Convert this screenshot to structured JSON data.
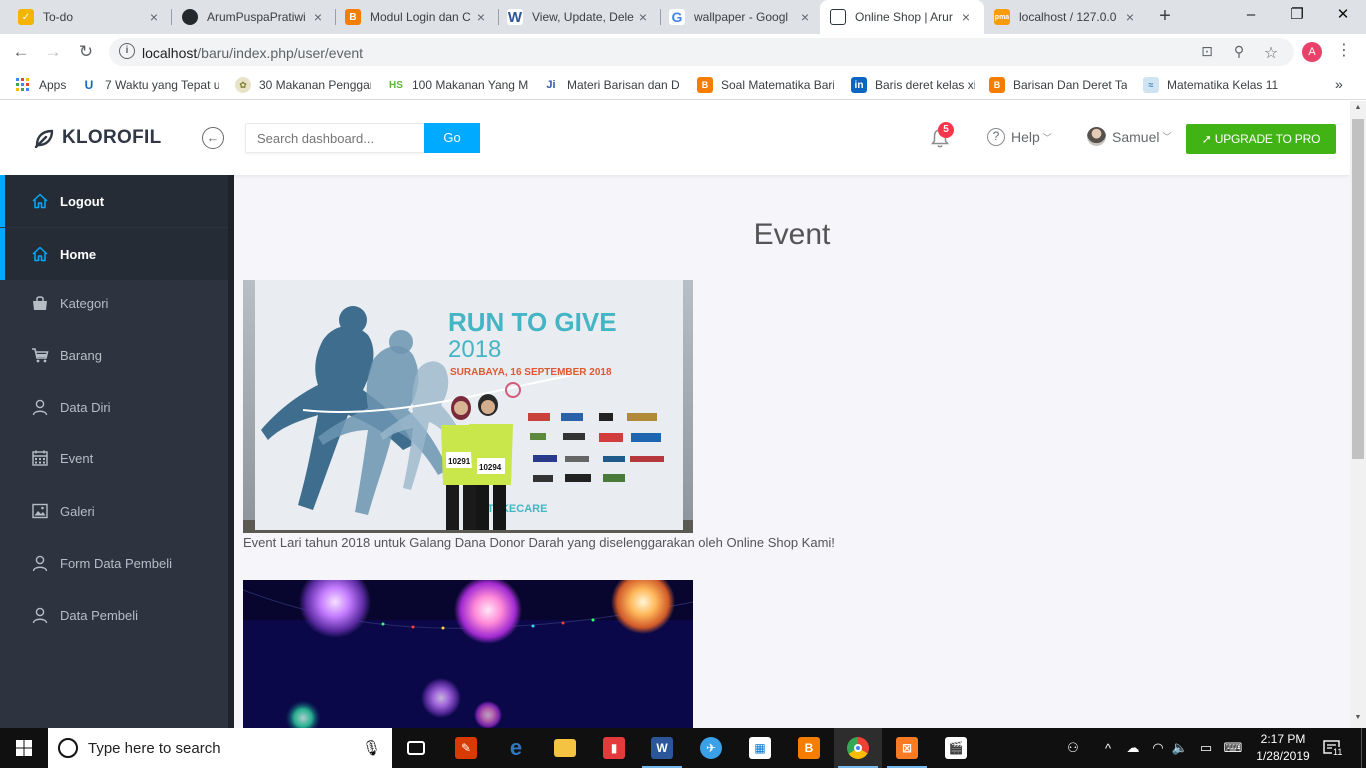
{
  "browser": {
    "tabs": [
      {
        "title": "To-do",
        "icon": "todo-icon",
        "color": "#f5b400"
      },
      {
        "title": "ArumPuspaPratiwi",
        "icon": "github-icon",
        "color": "#24292e"
      },
      {
        "title": "Modul Login dan C",
        "icon": "blogger-icon",
        "color": "#f57d00"
      },
      {
        "title": "View, Update, Dele",
        "icon": "word-icon",
        "color": "#2b579a"
      },
      {
        "title": "wallpaper - Googl",
        "icon": "google-icon",
        "color": "#4285f4"
      },
      {
        "title": "Online Shop | Arur",
        "icon": "klorofil-icon",
        "color": "#2d3440"
      },
      {
        "title": "localhost / 127.0.0",
        "icon": "phpmyadmin-icon",
        "color": "#f89c0e"
      }
    ],
    "url_host": "localhost",
    "url_path": "/baru/index.php/user/event",
    "profile_initial": "A",
    "bookmarks": [
      {
        "label": "Apps",
        "icon": "apps-icon",
        "color": "#4285f4"
      },
      {
        "label": "7 Waktu yang Tepat u",
        "icon": "uo-icon",
        "color": "#1565c0"
      },
      {
        "label": "30 Makanan Penggan",
        "icon": "food-icon",
        "color": "#7c7c2e"
      },
      {
        "label": "100 Makanan Yang M",
        "icon": "hs-icon",
        "color": "#5fb336"
      },
      {
        "label": "Materi Barisan dan D",
        "icon": "ji-icon",
        "color": "#2e58a6"
      },
      {
        "label": "Soal Matematika Bari",
        "icon": "blogger-icon",
        "color": "#f57d00"
      },
      {
        "label": "Baris deret kelas xi",
        "icon": "linkedin-icon",
        "color": "#0a66c2"
      },
      {
        "label": "Barisan Dan Deret Tak",
        "icon": "blogger-icon",
        "color": "#f57d00"
      },
      {
        "label": "Matematika Kelas 11",
        "icon": "math-icon",
        "color": "#7ab3d9"
      }
    ]
  },
  "header": {
    "brand": "KLOROFIL",
    "search_placeholder": "Search dashboard...",
    "go_label": "Go",
    "notif_count": "5",
    "help_label": "Help",
    "user_name": "Samuel",
    "upgrade_label": "UPGRADE TO PRO"
  },
  "sidebar": {
    "items": [
      {
        "label": "Logout",
        "icon": "home-icon"
      },
      {
        "label": "Home",
        "icon": "home-icon"
      },
      {
        "label": "Kategori",
        "icon": "bag-icon"
      },
      {
        "label": "Barang",
        "icon": "cart-icon"
      },
      {
        "label": "Data Diri",
        "icon": "user-icon"
      },
      {
        "label": "Event",
        "icon": "calendar-icon"
      },
      {
        "label": "Galeri",
        "icon": "picture-icon"
      },
      {
        "label": "Form Data Pembeli",
        "icon": "user-icon"
      },
      {
        "label": "Data Pembeli",
        "icon": "user-icon"
      }
    ]
  },
  "main": {
    "title": "Event",
    "events": [
      {
        "caption": "Event Lari tahun 2018 untuk Galang Dana Donor Darah yang diselenggarakan oleh Online Shop Kami!",
        "banner_title": "RUN TO GIVE",
        "banner_year": "2018",
        "banner_sub": "SURABAYA, 16 SEPTEMBER 2018",
        "banner_hashtag": "#TAKECARE",
        "bib_left": "10291",
        "bib_right": "10294"
      }
    ]
  },
  "taskbar": {
    "search_placeholder": "Type here to search",
    "time": "2:17 PM",
    "date": "1/28/2019",
    "notif_count": "11"
  }
}
